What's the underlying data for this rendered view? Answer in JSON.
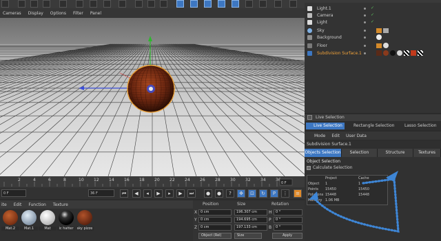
{
  "viewport_menu": [
    "Cameras",
    "Display",
    "Options",
    "Filter",
    "Panel"
  ],
  "objects": [
    {
      "name": "Light.1",
      "icon": "light-icon",
      "color": "#c8c8c8"
    },
    {
      "name": "Camera",
      "icon": "camera-icon",
      "color": "#c8c8c8"
    },
    {
      "name": "Light",
      "icon": "light-icon",
      "color": "#c8c8c8"
    },
    {
      "name": "Sky",
      "icon": "sky-icon",
      "color": "#c8c8c8"
    },
    {
      "name": "Background",
      "icon": "background-icon",
      "color": "#c8c8c8"
    },
    {
      "name": "Floor",
      "icon": "floor-icon",
      "color": "#c8c8c8"
    },
    {
      "name": "Subdivision Surface.1",
      "icon": "subdivision-icon",
      "color": "#f4a43a"
    }
  ],
  "selection": {
    "header": "Live Selection",
    "tabs": [
      "Live Selection",
      "Rectangle Selection",
      "Lasso Selection"
    ]
  },
  "attributes": {
    "menu": [
      "Mode",
      "Edit",
      "User Data"
    ],
    "title": "Subdivision Surface.1",
    "tabs": [
      "Objects Selection",
      "Selection",
      "Structure",
      "Textures"
    ],
    "section": "Object Selection",
    "calc_label": "Calculate Selection",
    "table_headers": [
      "Project",
      "Cache"
    ],
    "rows": [
      {
        "label": "Object",
        "project": "1",
        "cache": "1"
      },
      {
        "label": "Points",
        "project": "15450",
        "cache": "15450"
      },
      {
        "label": "Polygons",
        "project": "15448",
        "cache": "15448"
      },
      {
        "label": "Memory",
        "project": "1.06 MB",
        "cache": ""
      }
    ]
  },
  "timeline": {
    "ticks": [
      "2",
      "4",
      "6",
      "8",
      "10",
      "12",
      "14",
      "16",
      "18",
      "20",
      "22",
      "24",
      "26",
      "28",
      "30",
      "32",
      "34",
      "36"
    ],
    "current_frame": "0 F",
    "start_field": "0 F",
    "end_field": "36 F"
  },
  "materials": {
    "menu": [
      "ite",
      "Edit",
      "Function",
      "Texture"
    ],
    "items": [
      {
        "label": "Mat.2",
        "color": "#8a3a1c"
      },
      {
        "label": "Mat.1",
        "color": "#9fb3c8"
      },
      {
        "label": "Mat",
        "color": "#e8e8e8"
      },
      {
        "label": "ic hatter",
        "color": "#111111"
      },
      {
        "label": "sky pizze",
        "color": "#7a2c14"
      }
    ]
  },
  "coordinates": {
    "headers": [
      "Position",
      "Size",
      "Rotation"
    ],
    "rows": [
      {
        "axis": "X",
        "pos": "0 cm",
        "size": "196.307 cm",
        "rot_axis": "H",
        "rot": "0 °"
      },
      {
        "axis": "Y",
        "pos": "0 cm",
        "size": "194.695 cm",
        "rot_axis": "P",
        "rot": "0 °"
      },
      {
        "axis": "Z",
        "pos": "0 cm",
        "size": "197.133 cm",
        "rot_axis": "B",
        "rot": "0 °"
      }
    ],
    "mode_select": "Object (Rel)",
    "size_select": "Size",
    "apply_label": "Apply"
  },
  "colors": {
    "accent_blue": "#3d77c2",
    "selection_orange": "#f4a43a",
    "annotation_blue": "#3e86d6"
  }
}
